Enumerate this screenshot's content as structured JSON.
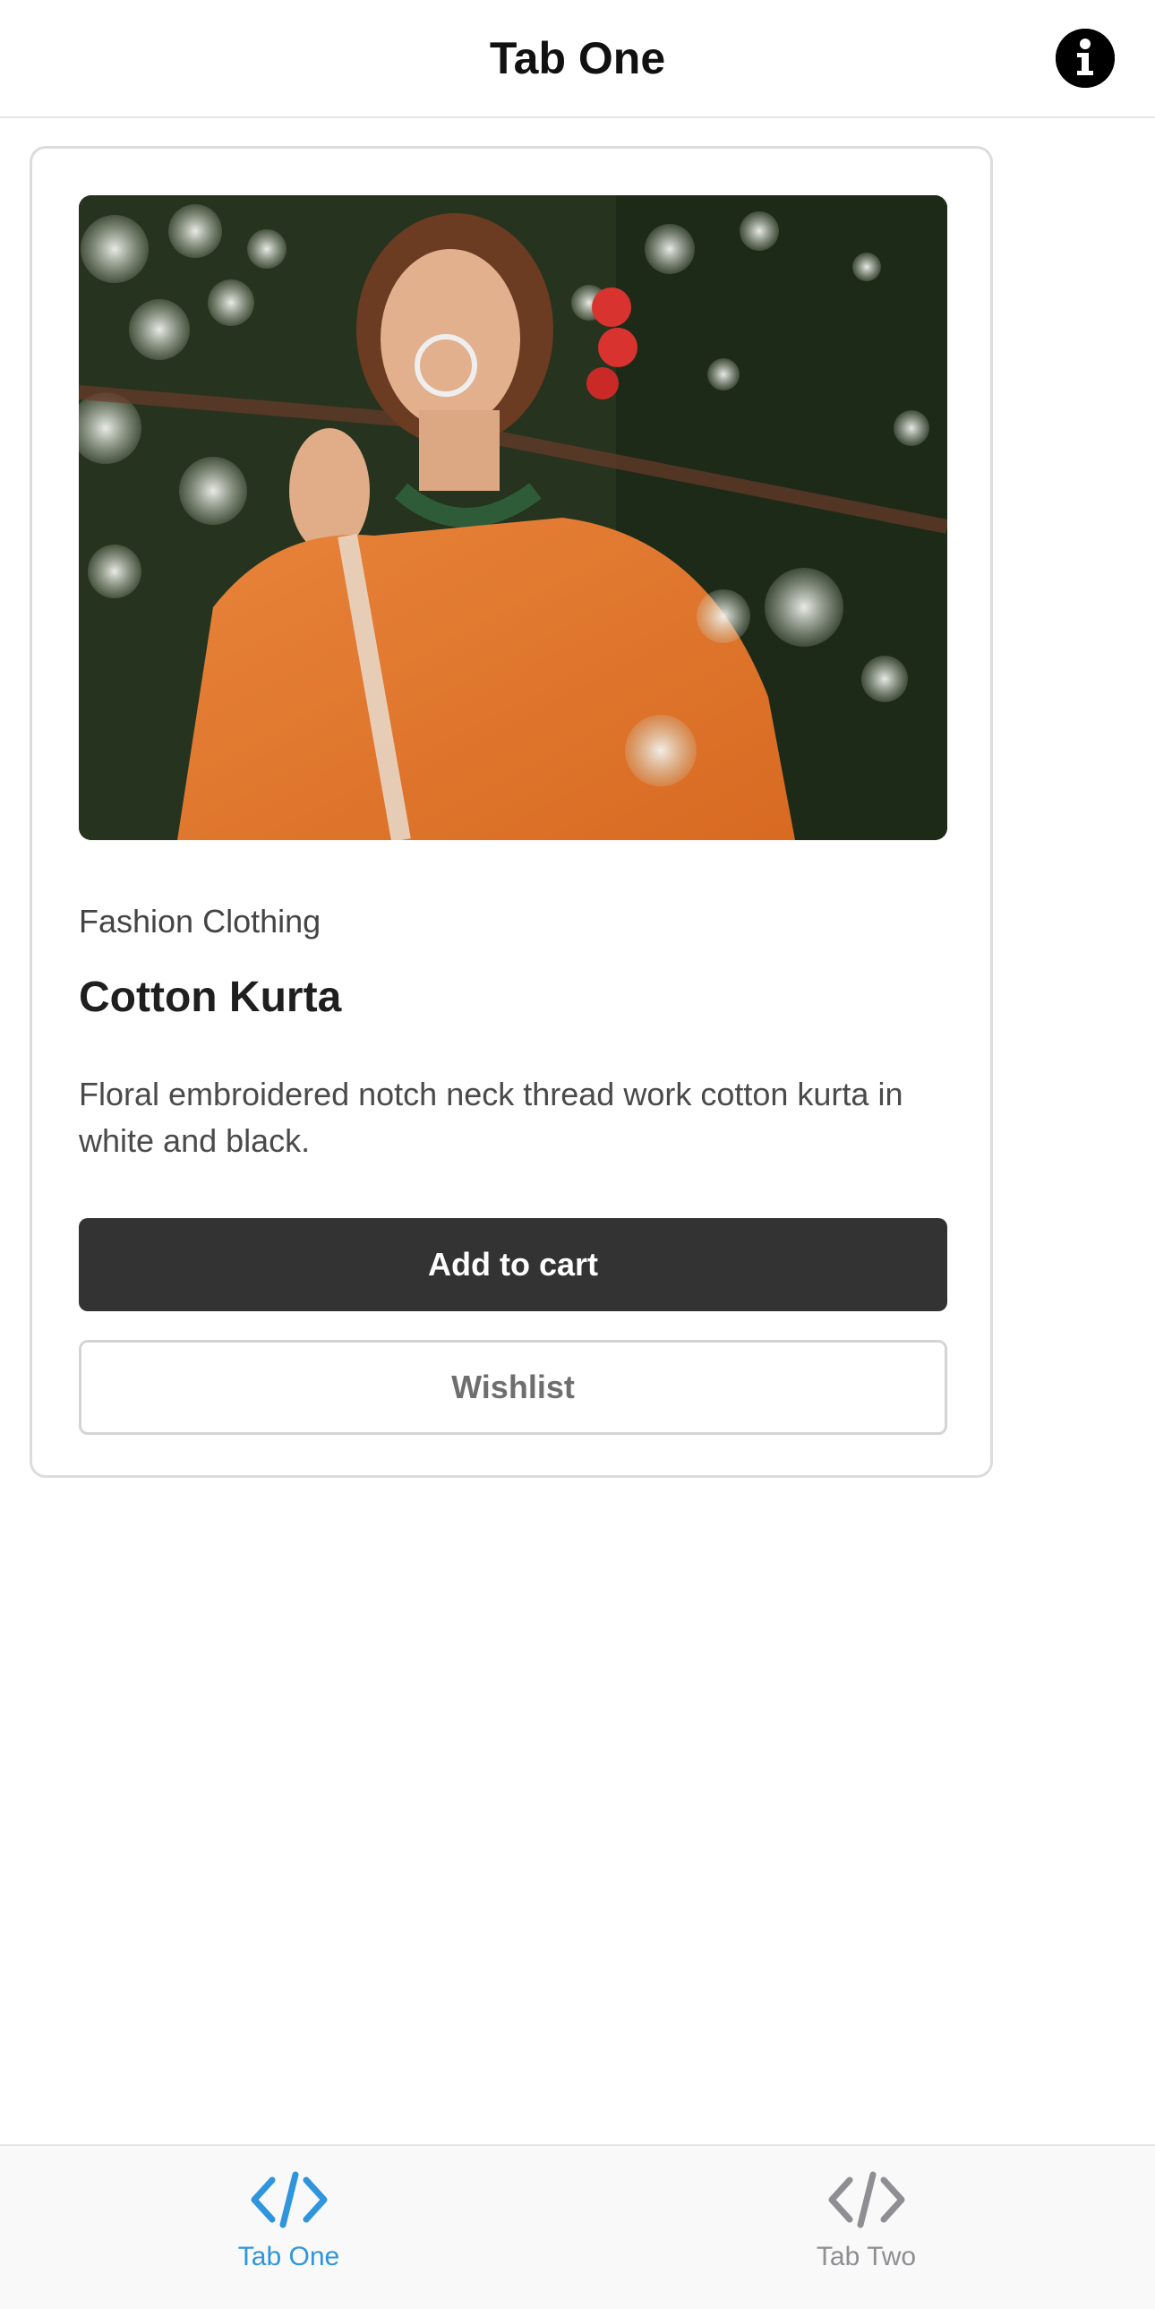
{
  "header": {
    "title": "Tab One",
    "info_icon": "info-circle-icon"
  },
  "product": {
    "image_icon": "product-photo",
    "category": "Fashion Clothing",
    "name": "Cotton Kurta",
    "description": "Floral embroidered notch neck thread work cotton kurta in white and black.",
    "add_to_cart_label": "Add to cart",
    "wishlist_label": "Wishlist"
  },
  "tabs": [
    {
      "label": "Tab One",
      "icon": "code-icon",
      "active": true,
      "color": "#2f95dc"
    },
    {
      "label": "Tab Two",
      "icon": "code-icon",
      "active": false,
      "color": "#8e8e93"
    }
  ],
  "colors": {
    "accent": "#2f95dc",
    "primary_button": "#333333",
    "inactive_tab": "#8e8e93"
  }
}
